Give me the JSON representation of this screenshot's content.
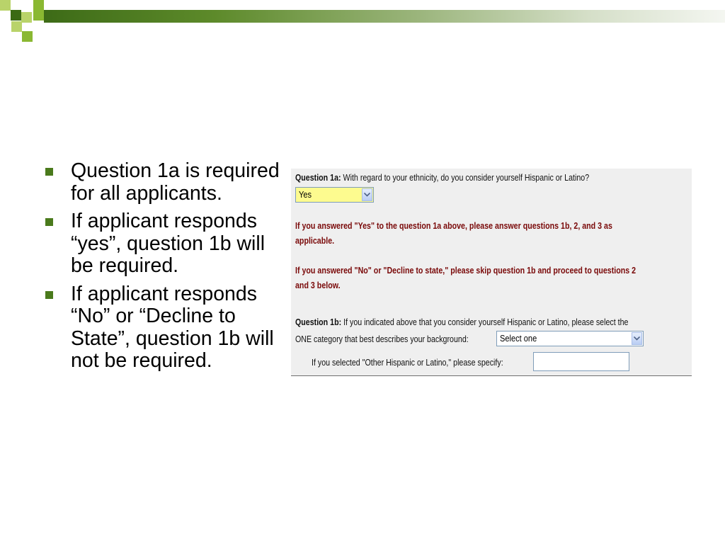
{
  "bullets": [
    "Question 1a is required for all applicants.",
    "If applicant responds “yes”, question 1b will be required.",
    "If applicant responds “No” or “Decline to State”, question 1b will not be required."
  ],
  "form": {
    "q1a": {
      "label": "Question 1a:",
      "text": " With regard to your ethnicity, do you consider yourself Hispanic or Latino?",
      "selected": "Yes"
    },
    "instruction_yes": [
      "If you answered \"Yes\" to the question 1a above, please answer questions 1b, 2, and 3 as",
      "applicable."
    ],
    "instruction_no": [
      "If you answered \"No\" or \"Decline to state,\" please skip question 1b and proceed to questions 2",
      "and 3 below."
    ],
    "q1b": {
      "label": "Question 1b:",
      "text_line1": " If you indicated above that you consider yourself Hispanic or Latino, please select the",
      "text_line2": "ONE category that best describes your background:",
      "selected": "Select one"
    },
    "other_specify": {
      "label": "If you selected \"Other Hispanic or Latino,\" please specify:",
      "value": ""
    }
  },
  "colors": {
    "header_dark": "#3b6a14",
    "header_accent": "#8ab832",
    "bullet": "#4a7a1c",
    "instruction_red": "#7a0a0a",
    "select_highlight": "#fdfb8f"
  }
}
